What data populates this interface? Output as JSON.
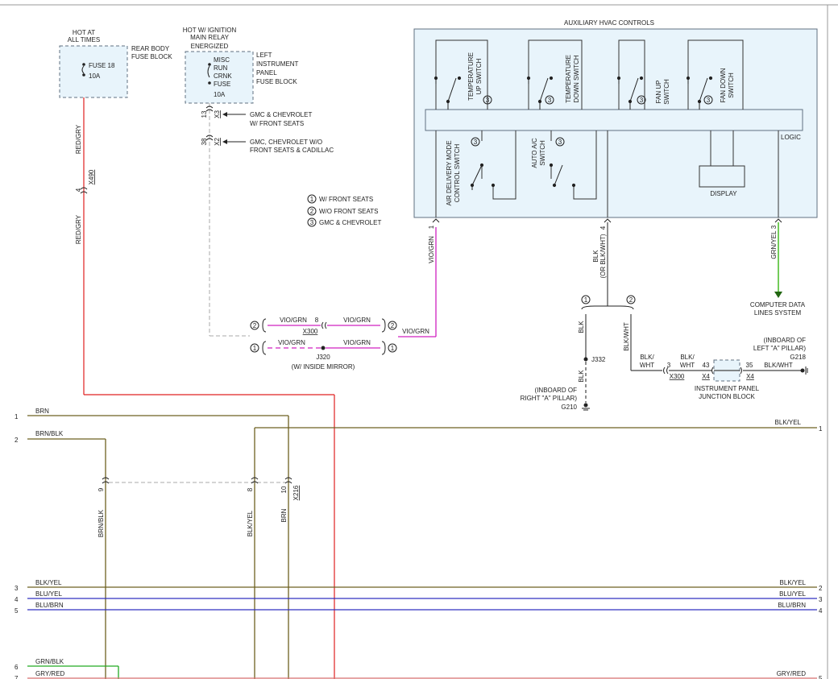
{
  "colors": {
    "red_gry": "#e02020",
    "vio_grn": "#d020c0",
    "grn_yel": "#44bb22",
    "brn": "#6e6020",
    "blu": "#3030c0",
    "grn_blk": "#22aa22",
    "gry_red": "#d87070",
    "gray": "#444444",
    "box_fill": "#e8f4fb",
    "box_stroke": "#607080"
  },
  "sources": {
    "hot_at_all_times": [
      "HOT AT",
      "ALL TIMES"
    ],
    "hot_w_ignition": [
      "HOT W/ IGNITION",
      "MAIN RELAY",
      "ENERGIZED"
    ],
    "rear_fuse_block": [
      "REAR BODY",
      "FUSE BLOCK"
    ],
    "left_ip_fuse_block": [
      "LEFT",
      "INSTRUMENT",
      "PANEL",
      "FUSE BLOCK"
    ],
    "fuse18": [
      "FUSE 18",
      "10A"
    ],
    "fuse_misc": [
      "MISC",
      "RUN",
      "CRNK",
      "FUSE",
      "10A"
    ]
  },
  "connectors": {
    "x3_pin": "13",
    "x3_label": "X3",
    "x2_pin": "38",
    "x2_label": "X2",
    "x3_note": [
      "GMC & CHEVROLET",
      "W/ FRONT SEATS"
    ],
    "x2_note": [
      "GMC, CHEVROLET W/O",
      "FRONT SEATS & CADILLAC"
    ],
    "x490_pin": "4",
    "x490_label": "X490",
    "x300_pin": "8",
    "x300_label": "X300",
    "j320": "J320",
    "j320_note": "(W/ INSIDE MIRROR)",
    "j332": "J332",
    "x216_pins": [
      "9",
      "8",
      "10"
    ],
    "x216_label": "X216",
    "x300b_pin": "3",
    "x300b_label": "X300",
    "x4_pins": [
      "43",
      "35"
    ],
    "x4_label": "X4"
  },
  "legend": [
    {
      "num": "1",
      "text": "W/ FRONT SEATS"
    },
    {
      "num": "2",
      "text": "W/O FRONT SEATS"
    },
    {
      "num": "3",
      "text": "GMC & CHEVROLET"
    }
  ],
  "hvac": {
    "title": "AUXILIARY HVAC CONTROLS",
    "switches_top": [
      [
        "TEMPERATURE",
        "UP SWITCH"
      ],
      [
        "TEMPERATURE",
        "DOWN SWITCH"
      ],
      [
        "FAN UP",
        "SWITCH"
      ],
      [
        "FAN DOWN",
        "SWITCH"
      ]
    ],
    "switches_bottom": [
      [
        "AIR DELIVERY MODE",
        "CONTROL SWITCH"
      ],
      [
        "AUTO A/C",
        "SWITCH"
      ]
    ],
    "logic": "LOGIC",
    "display": "DISPLAY",
    "note_num": "3",
    "pins": [
      "1",
      "4",
      "3"
    ]
  },
  "wires": {
    "red_gry": "RED/GRY",
    "vio_grn": "VIO/GRN",
    "grn_yel": "GRN/YEL",
    "blk": "BLK",
    "blk_or": [
      "BLK",
      "(OR BLK/WHT)"
    ],
    "blk_wht": "BLK/WHT",
    "blk_wht_split": [
      "BLK/",
      "WHT"
    ],
    "brn": "BRN",
    "brn_blk": "BRN/BLK",
    "blk_yel": "BLK/YEL",
    "blu_yel": "BLU/YEL",
    "blu_brn": "BLU/BRN",
    "grn_blk": "GRN/BLK",
    "gry_red": "GRY/RED"
  },
  "options": {
    "one": "1",
    "two": "2"
  },
  "grounds": {
    "g210": [
      "(INBOARD OF",
      "RIGHT \"A\" PILLAR)",
      "G210"
    ],
    "g218": [
      "(INBOARD OF",
      "LEFT \"A\" PILLAR)",
      "G218"
    ]
  },
  "computer_data": [
    "COMPUTER DATA",
    "LINES SYSTEM"
  ],
  "ip_junction": [
    "INSTRUMENT PANEL",
    "JUNCTION BLOCK"
  ],
  "left_numbers": [
    "1",
    "2",
    "3",
    "4",
    "5",
    "6",
    "7"
  ],
  "right_numbers": [
    "1",
    "2",
    "3",
    "4",
    "5"
  ]
}
